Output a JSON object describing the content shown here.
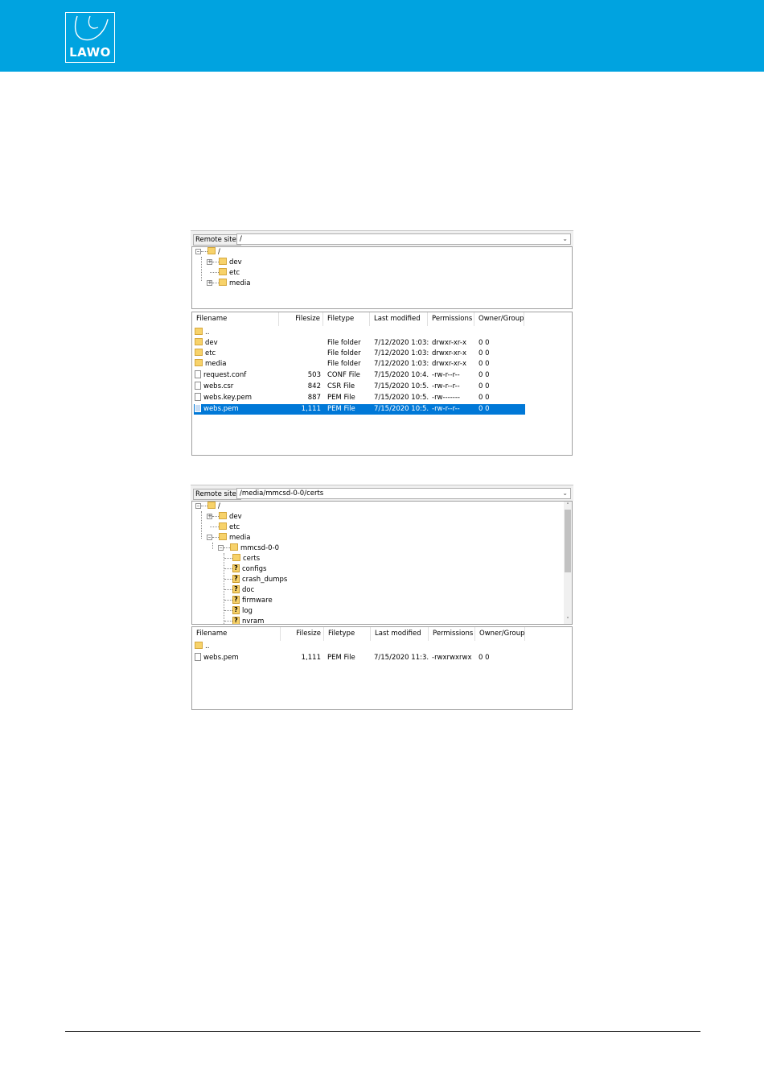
{
  "brand": {
    "logo_text": "LAWO",
    "header_color": "#00a3e0"
  },
  "panel_top": {
    "remote_label": "Remote site:",
    "remote_path": "/",
    "tree": [
      {
        "label": "/",
        "icon": "folder-icon",
        "expander": "minus"
      },
      {
        "label": "dev",
        "icon": "folder-icon",
        "expander": "plus"
      },
      {
        "label": "etc",
        "icon": "folder-icon",
        "expander": "none"
      },
      {
        "label": "media",
        "icon": "folder-icon",
        "expander": "plus"
      }
    ],
    "columns": [
      "Filename",
      "Filesize",
      "Filetype",
      "Last modified",
      "Permissions",
      "Owner/Group"
    ],
    "rows": [
      {
        "name": "..",
        "size": "",
        "type": "",
        "modified": "",
        "perm": "",
        "owner": "",
        "icon": "folder-icon"
      },
      {
        "name": "dev",
        "size": "",
        "type": "File folder",
        "modified": "7/12/2020 1:03:...",
        "perm": "drwxr-xr-x",
        "owner": "0 0",
        "icon": "folder-icon"
      },
      {
        "name": "etc",
        "size": "",
        "type": "File folder",
        "modified": "7/12/2020 1:03:...",
        "perm": "drwxr-xr-x",
        "owner": "0 0",
        "icon": "folder-icon"
      },
      {
        "name": "media",
        "size": "",
        "type": "File folder",
        "modified": "7/12/2020 1:03:...",
        "perm": "drwxr-xr-x",
        "owner": "0 0",
        "icon": "folder-icon"
      },
      {
        "name": "request.conf",
        "size": "503",
        "type": "CONF File",
        "modified": "7/15/2020 10:4...",
        "perm": "-rw-r--r--",
        "owner": "0 0",
        "icon": "file-icon"
      },
      {
        "name": "webs.csr",
        "size": "842",
        "type": "CSR File",
        "modified": "7/15/2020 10:5...",
        "perm": "-rw-r--r--",
        "owner": "0 0",
        "icon": "file-icon"
      },
      {
        "name": "webs.key.pem",
        "size": "887",
        "type": "PEM File",
        "modified": "7/15/2020 10:5...",
        "perm": "-rw-------",
        "owner": "0 0",
        "icon": "file-icon"
      },
      {
        "name": "webs.pem",
        "size": "1,111",
        "type": "PEM File",
        "modified": "7/15/2020 10:5...",
        "perm": "-rw-r--r--",
        "owner": "0 0",
        "icon": "file-icon",
        "selected": true
      }
    ]
  },
  "panel_bottom": {
    "remote_label": "Remote site:",
    "remote_path": "/media/mmcsd-0-0/certs",
    "tree": [
      {
        "label": "/",
        "icon": "folder-icon"
      },
      {
        "label": "dev",
        "icon": "folder-icon"
      },
      {
        "label": "etc",
        "icon": "folder-icon"
      },
      {
        "label": "media",
        "icon": "folder-icon"
      },
      {
        "label": "mmcsd-0-0",
        "icon": "folder-icon"
      },
      {
        "label": "certs",
        "icon": "folder-icon"
      },
      {
        "label": "configs",
        "icon": "unknown-folder-icon"
      },
      {
        "label": "crash_dumps",
        "icon": "unknown-folder-icon"
      },
      {
        "label": "doc",
        "icon": "unknown-folder-icon"
      },
      {
        "label": "firmware",
        "icon": "unknown-folder-icon"
      },
      {
        "label": "log",
        "icon": "unknown-folder-icon"
      },
      {
        "label": "nvram",
        "icon": "unknown-folder-icon"
      }
    ],
    "columns": [
      "Filename",
      "Filesize",
      "Filetype",
      "Last modified",
      "Permissions",
      "Owner/Group"
    ],
    "rows": [
      {
        "name": "..",
        "size": "",
        "type": "",
        "modified": "",
        "perm": "",
        "owner": "",
        "icon": "folder-icon"
      },
      {
        "name": "webs.pem",
        "size": "1,111",
        "type": "PEM File",
        "modified": "7/15/2020 11:3...",
        "perm": "-rwxrwxrwx",
        "owner": "0 0",
        "icon": "file-icon"
      }
    ],
    "selected_color": "#0078d7"
  }
}
